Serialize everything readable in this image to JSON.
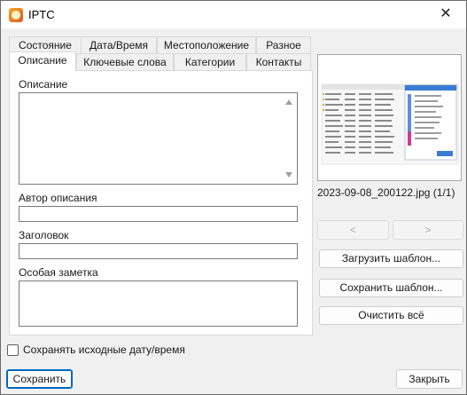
{
  "window": {
    "title": "IPTC",
    "close_glyph": "✕"
  },
  "tabs_row1": [
    "Состояние",
    "Дата/Время",
    "Местоположение",
    "Разное"
  ],
  "tabs_row2": [
    "Описание",
    "Ключевые слова",
    "Категории",
    "Контакты"
  ],
  "active_tab": "Описание",
  "fields": {
    "description_label": "Описание",
    "description_value": "",
    "author_label": "Автор описания",
    "author_value": "",
    "headline_label": "Заголовок",
    "headline_value": "",
    "special_label": "Особая заметка",
    "special_value": ""
  },
  "preview": {
    "filename": "2023-09-08_200122.jpg (1/1)",
    "prev_label": "<",
    "next_label": ">"
  },
  "buttons": {
    "load_template": "Загрузить шаблон...",
    "save_template": "Сохранить шаблон...",
    "clear_all": "Очистить всё",
    "save": "Сохранить",
    "close": "Закрыть"
  },
  "keep_dates": {
    "label": "Сохранять исходные дату/время",
    "checked": false
  },
  "icons": {
    "app": "photo-app-icon",
    "close": "close-icon"
  },
  "colors": {
    "accent": "#0067c0",
    "window_bg": "#f0f0f0"
  }
}
